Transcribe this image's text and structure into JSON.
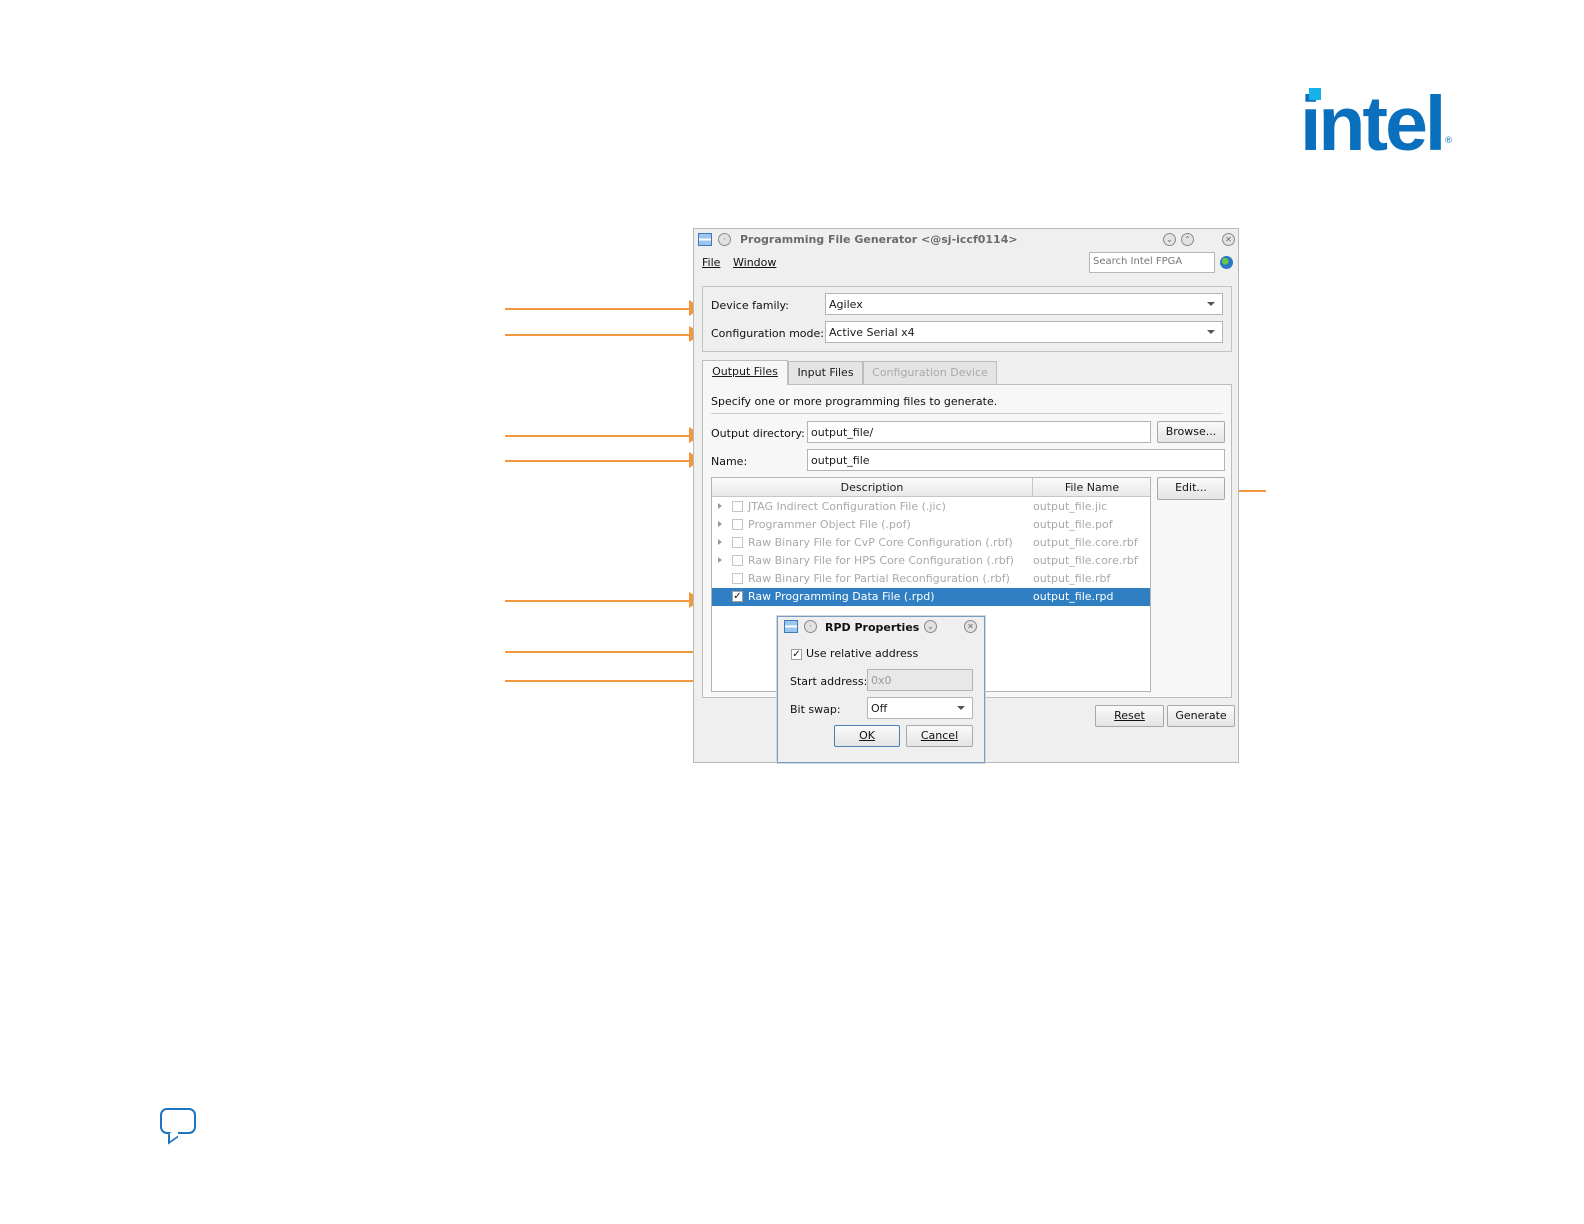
{
  "logo": {
    "text": "intel",
    "mark": "®"
  },
  "window": {
    "title": "Programming File Generator  <@sj-iccf0114>",
    "menu": [
      "File",
      "Window"
    ],
    "search_placeholder": "Search Intel FPGA"
  },
  "device": {
    "family_label": "Device family:",
    "family_value": "Agilex",
    "config_label": "Configuration mode:",
    "config_value": "Active Serial x4"
  },
  "tabs": [
    "Output Files",
    "Input Files",
    "Configuration Device"
  ],
  "output": {
    "instruction": "Specify one or more programming files to generate.",
    "dir_label": "Output directory:",
    "dir_value": "output_file/",
    "browse_label": "Browse...",
    "name_label": "Name:",
    "name_value": "output_file",
    "edit_label": "Edit..."
  },
  "table": {
    "columns": [
      "Description",
      "File Name"
    ],
    "rows": [
      {
        "desc": "JTAG Indirect Configuration File (.jic)",
        "file": "output_file.jic",
        "checked": false,
        "expandable": true
      },
      {
        "desc": "Programmer Object File (.pof)",
        "file": "output_file.pof",
        "checked": false,
        "expandable": true
      },
      {
        "desc": "Raw Binary File for CvP Core Configuration (.rbf)",
        "file": "output_file.core.rbf",
        "checked": false,
        "expandable": true
      },
      {
        "desc": "Raw Binary File for HPS Core Configuration (.rbf)",
        "file": "output_file.core.rbf",
        "checked": false,
        "expandable": true
      },
      {
        "desc": "Raw Binary File for Partial Reconfiguration (.rbf)",
        "file": "output_file.rbf",
        "checked": false,
        "expandable": false
      },
      {
        "desc": "Raw Programming Data File (.rpd)",
        "file": "output_file.rpd",
        "checked": true,
        "expandable": false
      }
    ]
  },
  "buttons": {
    "reset": "Reset",
    "generate": "Generate"
  },
  "dialog": {
    "title": "RPD Properties",
    "use_relative_label": "Use relative address",
    "use_relative_checked": true,
    "start_label": "Start address:",
    "start_value": "0x0",
    "bitswap_label": "Bit swap:",
    "bitswap_value": "Off",
    "ok": "OK",
    "cancel": "Cancel"
  },
  "colors": {
    "callout": "#f29a3b",
    "selection": "#2f7fc2",
    "brand": "#0a6fbd"
  }
}
